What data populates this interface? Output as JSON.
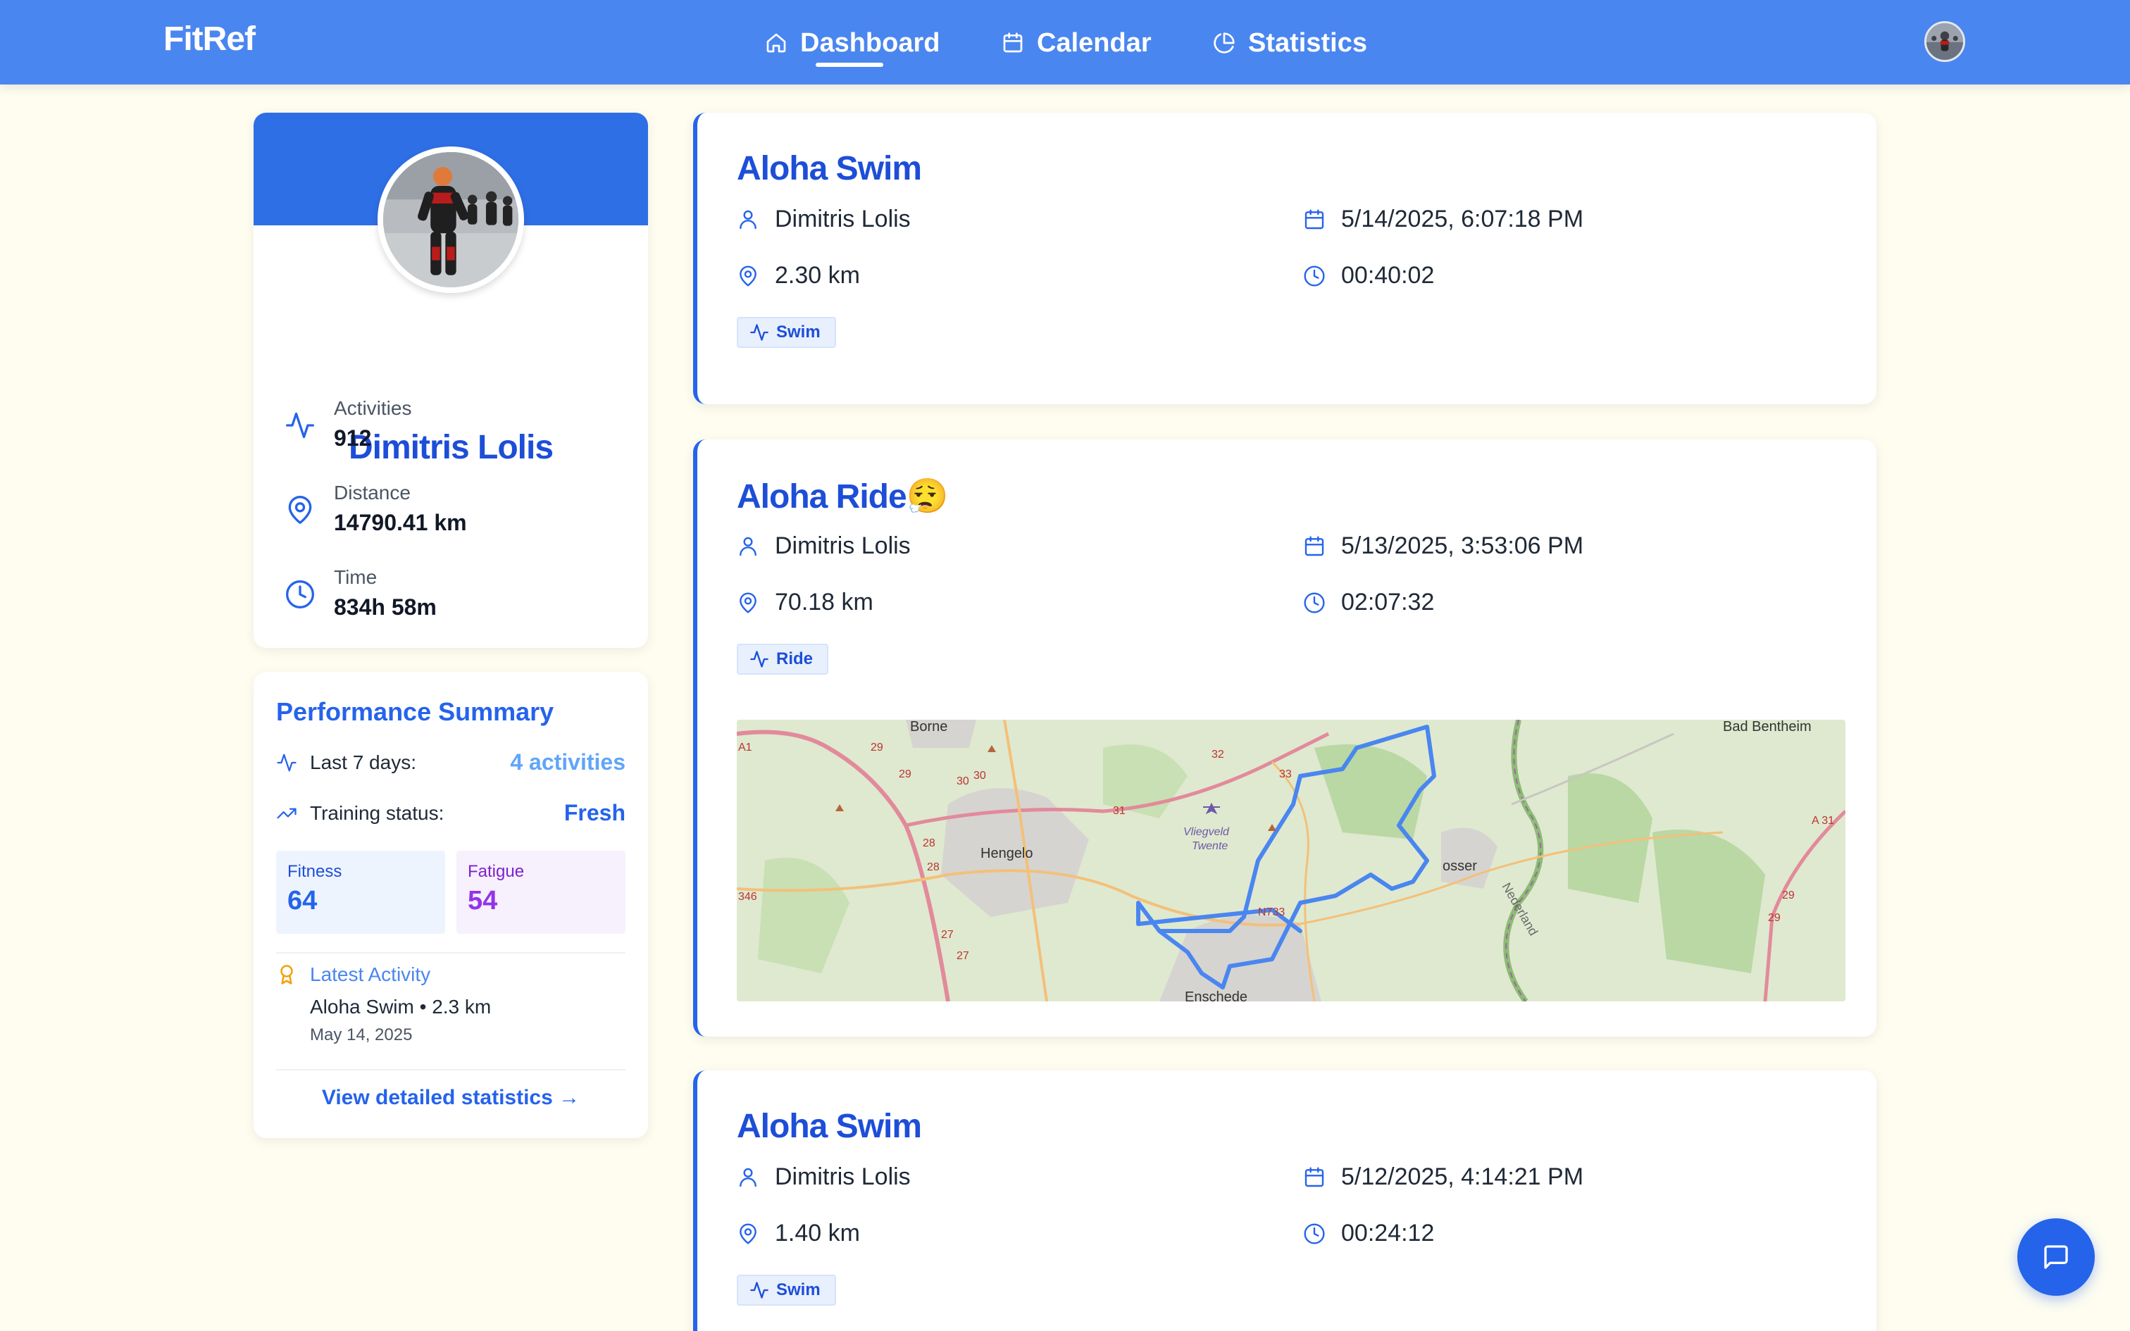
{
  "app": {
    "brand": "FitRef"
  },
  "nav": {
    "items": [
      {
        "label": "Dashboard",
        "icon": "home-icon",
        "active": true
      },
      {
        "label": "Calendar",
        "icon": "calendar-icon"
      },
      {
        "label": "Statistics",
        "icon": "pie-chart-icon"
      }
    ]
  },
  "profile": {
    "name": "Dimitris Lolis",
    "stats": [
      {
        "label": "Activities",
        "value": "912",
        "icon": "activity-icon"
      },
      {
        "label": "Distance",
        "value": "14790.41 km",
        "icon": "map-pin-icon"
      },
      {
        "label": "Time",
        "value": "834h 58m",
        "icon": "clock-icon"
      }
    ]
  },
  "performance": {
    "title": "Performance Summary",
    "last7_label": "Last 7 days:",
    "last7_value": "4 activities",
    "status_label": "Training status:",
    "status_value": "Fresh",
    "fitness_label": "Fitness",
    "fitness_value": "64",
    "fatigue_label": "Fatigue",
    "fatigue_value": "54",
    "latest_label": "Latest Activity",
    "latest_line": "Aloha Swim • 2.3 km",
    "latest_date": "May 14, 2025",
    "view_link": "View detailed statistics →"
  },
  "activities": [
    {
      "title": "Aloha Swim",
      "athlete": "Dimitris Lolis",
      "date": "5/14/2025, 6:07:18 PM",
      "distance": "2.30 km",
      "duration": "00:40:02",
      "type": "Swim"
    },
    {
      "title": "Aloha Ride😮‍💨",
      "athlete": "Dimitris Lolis",
      "date": "5/13/2025, 3:53:06 PM",
      "distance": "70.18 km",
      "duration": "02:07:32",
      "type": "Ride",
      "map_labels": {
        "borne": "Borne",
        "hengelo": "Hengelo",
        "bad_bentheim": "Bad Bentheim",
        "losser": "osser",
        "enschede": "Enschede",
        "nederland": "Nederland",
        "vliegveld": "Vliegveld",
        "twente": "Twente",
        "a1": "A1",
        "a31": "A 31",
        "r346": "346",
        "n733": "N733",
        "r29a": "29",
        "r29b": "29",
        "r29c": "29",
        "r29d": "29",
        "r30": "30",
        "r30b": "30",
        "r31": "31",
        "r32": "32",
        "r33": "33",
        "r28a": "28",
        "r28b": "28",
        "r27a": "27",
        "r27b": "27"
      }
    },
    {
      "title": "Aloha Swim",
      "athlete": "Dimitris Lolis",
      "date": "5/12/2025, 4:14:21 PM",
      "distance": "1.40 km",
      "duration": "00:24:12",
      "type": "Swim"
    }
  ],
  "colors": {
    "nav": "#4a86f0",
    "primary": "#2563eb",
    "title": "#1d4ed8",
    "background": "#fefdf0",
    "fatigue": "#9333ea"
  }
}
